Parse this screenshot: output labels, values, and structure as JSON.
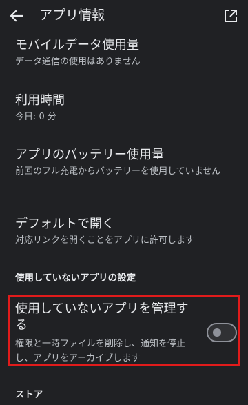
{
  "appbar": {
    "title": "アプリ情報",
    "back_icon": "arrow-back-icon",
    "open_icon": "open-in-new-icon"
  },
  "items": [
    {
      "title": "モバイルデータ使用量",
      "summary": "データ通信の使用はありません"
    },
    {
      "title": "利用時間",
      "summary": "今日: 0 分"
    },
    {
      "title": "アプリのバッテリー使用量",
      "summary": "前回のフル充電からバッテリーを使用していません"
    },
    {
      "title": "デフォルトで開く",
      "summary": "対応リンクを開くことをアプリに許可します"
    }
  ],
  "unused_section": {
    "header": "使用していないアプリの設定",
    "manage_title": "使用していないアプリを管理する",
    "manage_summary": "権限と一時ファイルを削除し、通知を停止し、アプリをアーカイブします",
    "toggle_on": false
  },
  "store_section": {
    "header": "ストア"
  },
  "colors": {
    "background": "#202124",
    "highlight": "#e11b1b"
  }
}
